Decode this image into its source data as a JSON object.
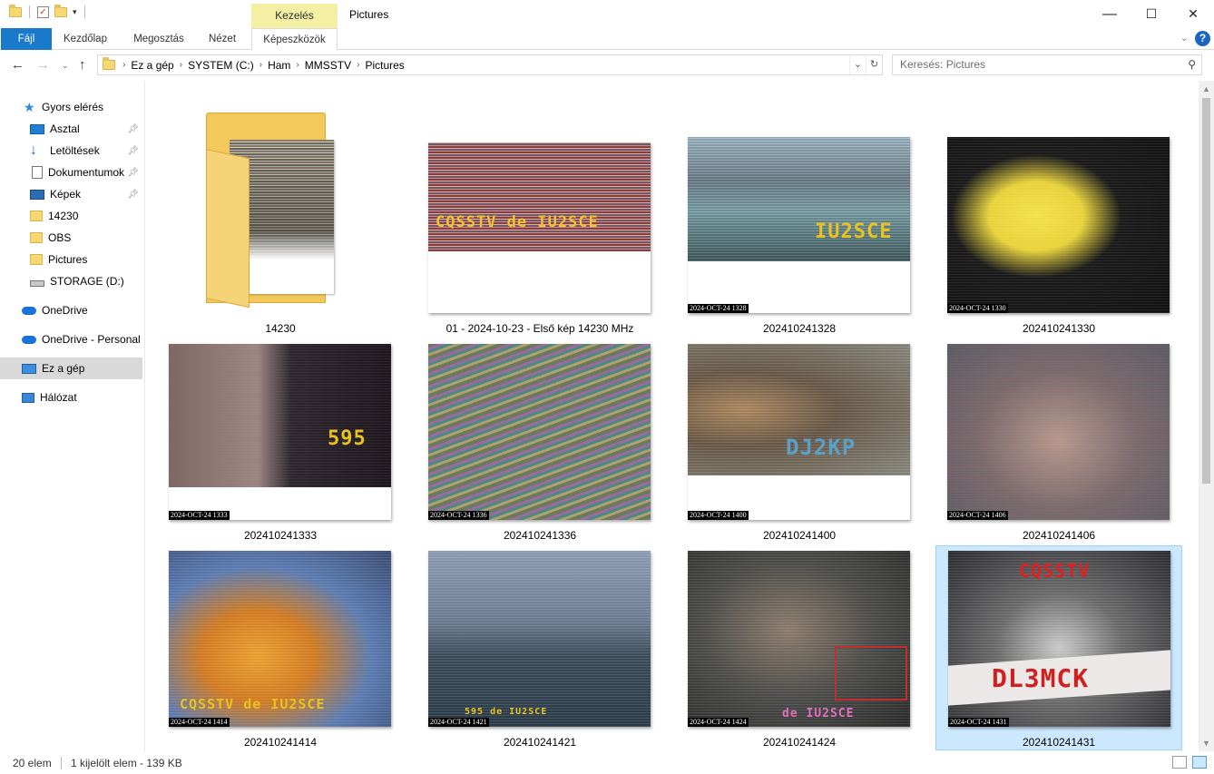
{
  "window": {
    "title": "Pictures",
    "context_tab_group": "Kezelés",
    "minimize": "—",
    "maximize": "☐",
    "close": "✕"
  },
  "ribbon": {
    "tabs": [
      "Fájl",
      "Kezdőlap",
      "Megosztás",
      "Nézet",
      "Képeszközök"
    ],
    "help": "?"
  },
  "address": {
    "crumbs": [
      "Ez a gép",
      "SYSTEM (C:)",
      "Ham",
      "MMSSTV",
      "Pictures"
    ],
    "search_placeholder": "Keresés: Pictures"
  },
  "sidebar": {
    "items": [
      {
        "label": "Gyors elérés",
        "icon": "star-icon"
      },
      {
        "label": "Asztal",
        "icon": "desktop-icon",
        "pinned": true
      },
      {
        "label": "Letöltések",
        "icon": "download-icon",
        "pinned": true
      },
      {
        "label": "Dokumentumok",
        "icon": "document-icon",
        "pinned": true
      },
      {
        "label": "Képek",
        "icon": "pictures-icon",
        "pinned": true
      },
      {
        "label": "14230",
        "icon": "folder-icon"
      },
      {
        "label": "OBS",
        "icon": "folder-icon"
      },
      {
        "label": "Pictures",
        "icon": "folder-icon"
      },
      {
        "label": "STORAGE (D:)",
        "icon": "drive-icon"
      },
      {
        "label": "OneDrive",
        "icon": "onedrive-icon"
      },
      {
        "label": "OneDrive - Personal",
        "icon": "onedrive-icon"
      },
      {
        "label": "Ez a gép",
        "icon": "this-pc-icon",
        "selected": true
      },
      {
        "label": "Hálózat",
        "icon": "network-icon"
      }
    ]
  },
  "files": [
    {
      "name": "14230",
      "type": "folder"
    },
    {
      "name": "01 - 2024-10-23 - Első kép 14230 MHz",
      "overlay": "CQSSTV de IU2SCE"
    },
    {
      "name": "202410241328",
      "stamp": "2024-OCT-24 1328",
      "overlay": "IU2SCE"
    },
    {
      "name": "202410241330",
      "stamp": "2024-OCT-24 1330",
      "overlay": ""
    },
    {
      "name": "202410241333",
      "stamp": "2024-OCT-24 1333",
      "overlay": "595"
    },
    {
      "name": "202410241336",
      "stamp": "2024-OCT-24 1336",
      "overlay": ""
    },
    {
      "name": "202410241400",
      "stamp": "2024-OCT-24 1400",
      "overlay": "DJ2KP"
    },
    {
      "name": "202410241406",
      "stamp": "2024-OCT-24 1406",
      "overlay": ""
    },
    {
      "name": "202410241414",
      "stamp": "2024-OCT-24 1414",
      "overlay": "CQSSTV de IU2SCE"
    },
    {
      "name": "202410241421",
      "stamp": "2024-OCT-24 1421",
      "overlay": "595 de IU2SCE"
    },
    {
      "name": "202410241424",
      "stamp": "2024-OCT-24 1424",
      "overlay": "de IU2SCE"
    },
    {
      "name": "202410241431",
      "stamp": "2024-OCT-24 1431",
      "overlay": "DL3MCK",
      "overlay2": "CQSSTV",
      "selected": true
    }
  ],
  "status": {
    "count": "20 elem",
    "selection": "1 kijelölt elem - 139 KB"
  }
}
